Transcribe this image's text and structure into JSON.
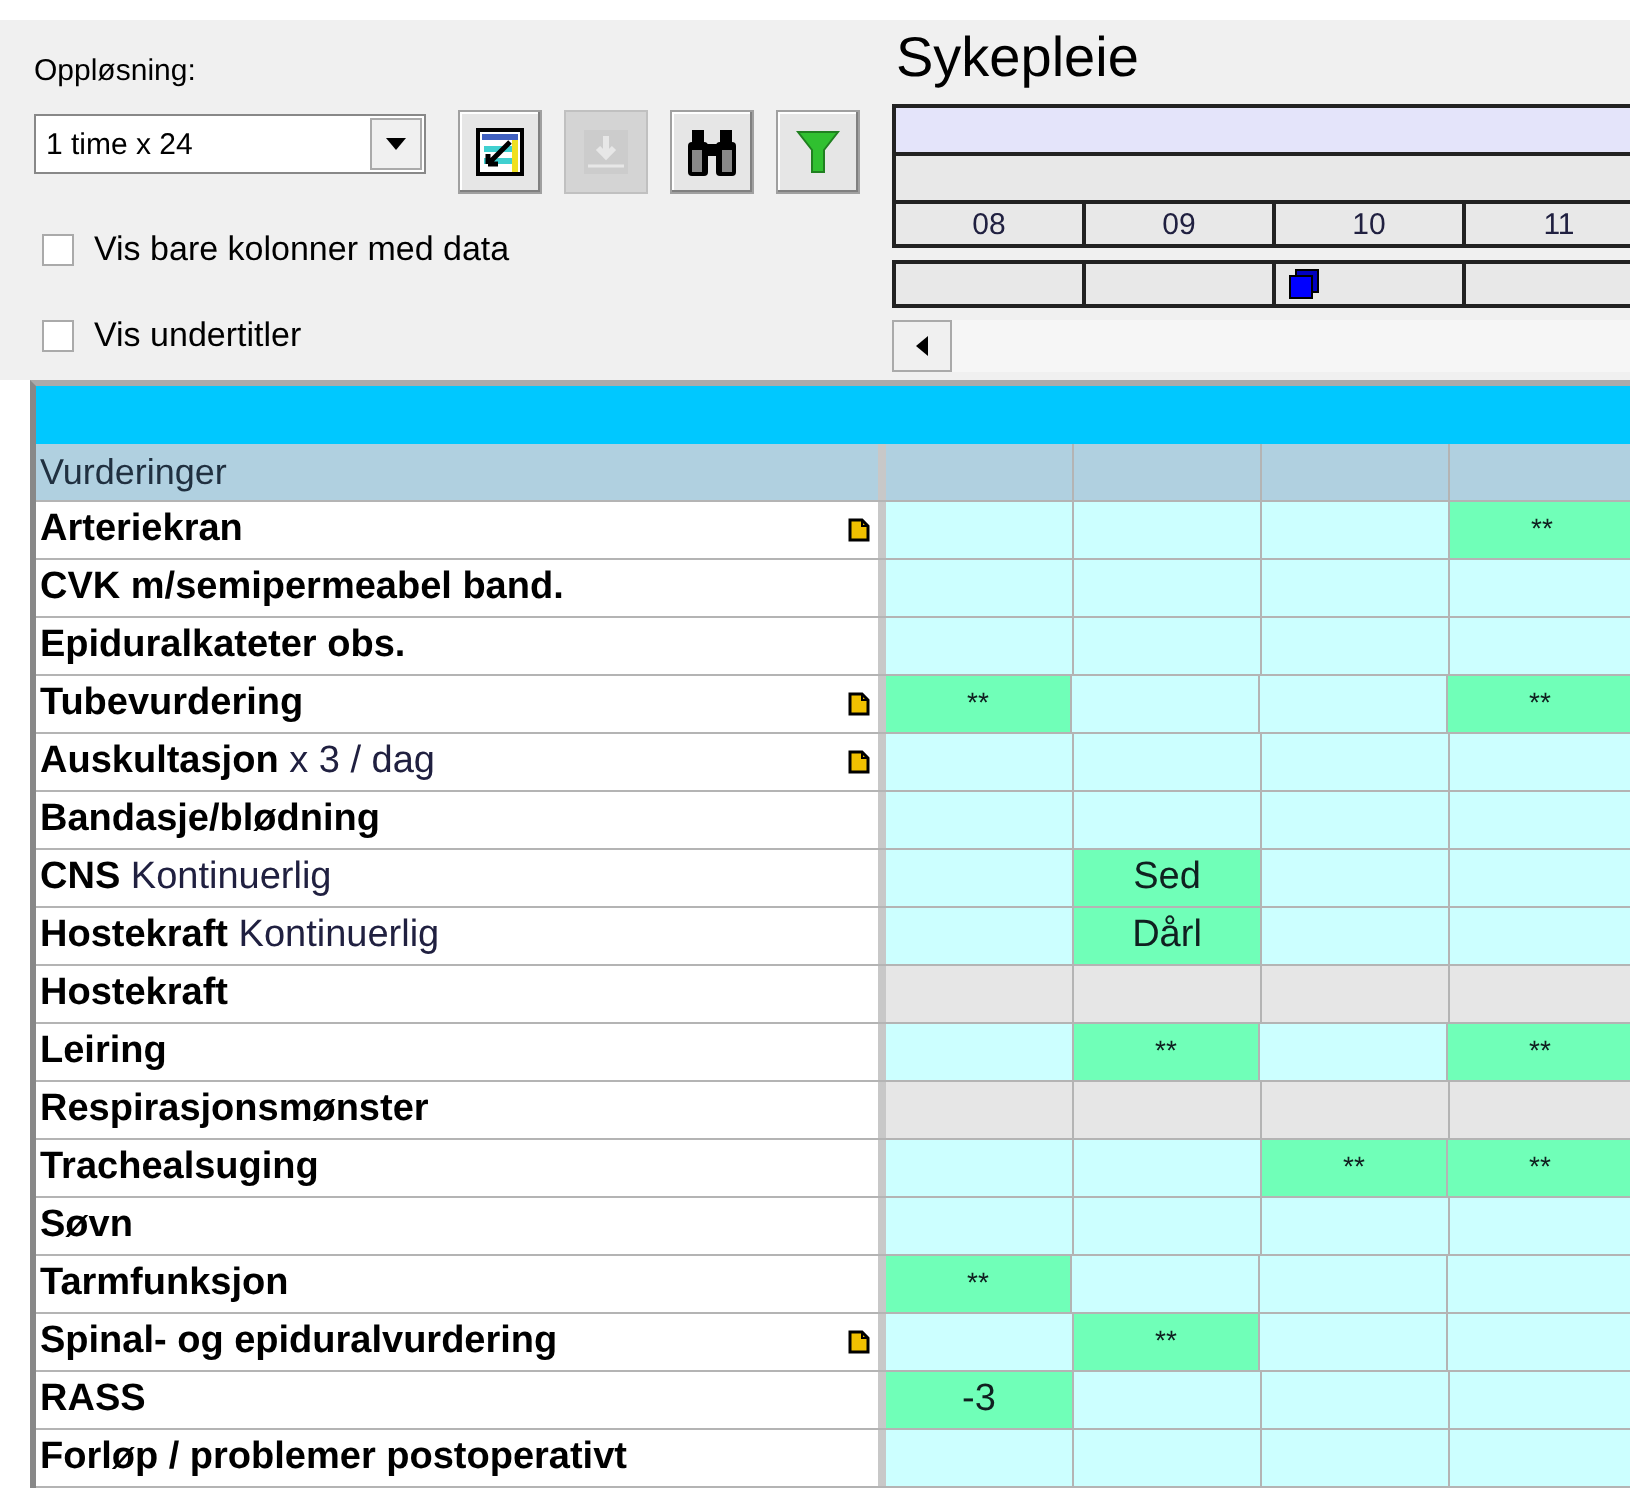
{
  "resolution": {
    "label": "Oppløsning:",
    "value": "1 time x 24"
  },
  "tool_buttons": [
    {
      "kind": "edit-chart",
      "disabled": false
    },
    {
      "kind": "import",
      "disabled": true
    },
    {
      "kind": "binoculars",
      "disabled": false
    },
    {
      "kind": "filter",
      "disabled": false
    }
  ],
  "options": [
    {
      "label": "Vis bare kolonner med data",
      "checked": false
    },
    {
      "label": "Vis undertitler",
      "checked": false
    }
  ],
  "title": "Sykepleie",
  "timeline": {
    "hours": [
      {
        "label": "08",
        "marker": false
      },
      {
        "label": "09",
        "marker": false
      },
      {
        "label": "10",
        "marker": true
      },
      {
        "label": "11",
        "marker": false
      }
    ]
  },
  "grid": {
    "section": "Vurderinger",
    "rows": [
      {
        "name": "Arteriekran",
        "note": true,
        "shaded": false,
        "cells": [
          {
            "filled": false
          },
          {
            "filled": false
          },
          {
            "filled": false
          },
          {
            "text": "**",
            "filled": true
          }
        ]
      },
      {
        "name": "CVK m/semipermeabel band.",
        "note": false,
        "shaded": false,
        "cells": [
          {
            "filled": false
          },
          {
            "filled": false
          },
          {
            "filled": false
          },
          {
            "filled": false
          }
        ]
      },
      {
        "name": "Epiduralkateter obs.",
        "note": false,
        "shaded": false,
        "cells": [
          {
            "filled": false
          },
          {
            "filled": false
          },
          {
            "filled": false
          },
          {
            "filled": false
          }
        ]
      },
      {
        "name": "Tubevurdering",
        "note": true,
        "shaded": false,
        "cells": [
          {
            "text": "**",
            "filled": true
          },
          {
            "filled": false
          },
          {
            "filled": false
          },
          {
            "text": "**",
            "filled": true
          }
        ]
      },
      {
        "name": "Auskultasjon",
        "detail": "x 3 / dag",
        "note": true,
        "shaded": false,
        "cells": [
          {
            "filled": false
          },
          {
            "filled": false
          },
          {
            "filled": false
          },
          {
            "filled": false
          }
        ]
      },
      {
        "name": "Bandasje/blødning",
        "note": false,
        "shaded": false,
        "cells": [
          {
            "filled": false
          },
          {
            "filled": false
          },
          {
            "filled": false
          },
          {
            "filled": false
          }
        ]
      },
      {
        "name": "CNS",
        "detail": "Kontinuerlig",
        "note": false,
        "shaded": false,
        "cells": [
          {
            "filled": false
          },
          {
            "text": "Sed",
            "filled": true
          },
          {
            "filled": false
          },
          {
            "filled": false
          }
        ]
      },
      {
        "name": "Hostekraft",
        "detail": "Kontinuerlig",
        "note": false,
        "shaded": false,
        "cells": [
          {
            "filled": false
          },
          {
            "text": "Dårl",
            "filled": true
          },
          {
            "filled": false
          },
          {
            "filled": false
          }
        ]
      },
      {
        "name": "Hostekraft",
        "note": false,
        "shaded": true,
        "cells": [
          {
            "filled": false
          },
          {
            "filled": false
          },
          {
            "filled": false
          },
          {
            "filled": false
          }
        ]
      },
      {
        "name": "Leiring",
        "note": false,
        "shaded": false,
        "cells": [
          {
            "filled": false
          },
          {
            "text": "**",
            "filled": true
          },
          {
            "filled": false
          },
          {
            "text": "**",
            "filled": true
          }
        ]
      },
      {
        "name": "Respirasjonsmønster",
        "note": false,
        "shaded": true,
        "cells": [
          {
            "filled": false
          },
          {
            "filled": false
          },
          {
            "filled": false
          },
          {
            "filled": false
          }
        ]
      },
      {
        "name": "Trachealsuging",
        "note": false,
        "shaded": false,
        "cells": [
          {
            "filled": false
          },
          {
            "filled": false
          },
          {
            "text": "**",
            "filled": true
          },
          {
            "text": "**",
            "filled": true
          }
        ]
      },
      {
        "name": "Søvn",
        "note": false,
        "shaded": false,
        "cells": [
          {
            "filled": false
          },
          {
            "filled": false
          },
          {
            "filled": false
          },
          {
            "filled": false
          }
        ]
      },
      {
        "name": "Tarmfunksjon",
        "note": false,
        "shaded": false,
        "cells": [
          {
            "text": "**",
            "filled": true
          },
          {
            "filled": false
          },
          {
            "filled": false
          },
          {
            "filled": false
          }
        ]
      },
      {
        "name": "Spinal- og epiduralvurdering",
        "note": true,
        "shaded": false,
        "cells": [
          {
            "filled": false
          },
          {
            "text": "**",
            "filled": true
          },
          {
            "filled": false
          },
          {
            "filled": false
          }
        ]
      },
      {
        "name": "RASS",
        "note": false,
        "shaded": false,
        "cells": [
          {
            "text": "-3",
            "filled": true
          },
          {
            "filled": false
          },
          {
            "filled": false
          },
          {
            "filled": false
          }
        ]
      },
      {
        "name": "Forløp / problemer postoperativt",
        "note": false,
        "shaded": false,
        "cells": [
          {
            "filled": false
          },
          {
            "filled": false
          },
          {
            "filled": false
          },
          {
            "filled": false
          }
        ]
      }
    ]
  }
}
